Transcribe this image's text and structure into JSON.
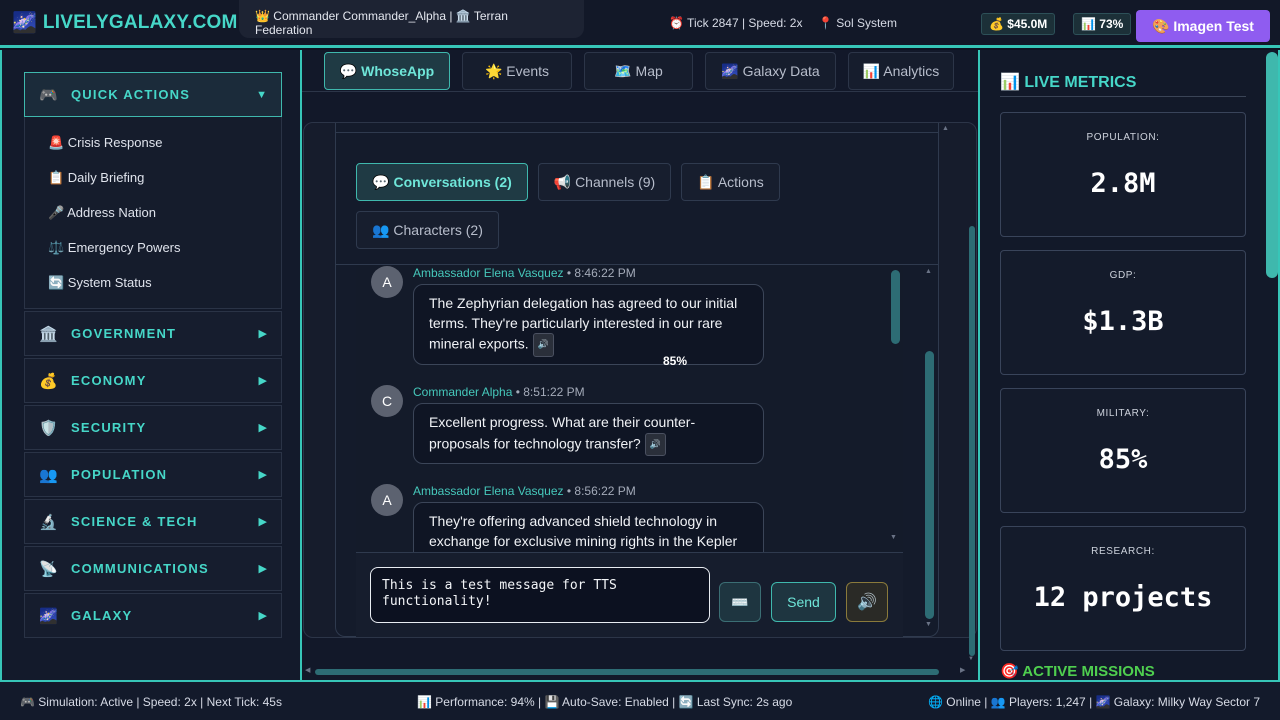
{
  "header": {
    "logo_glyph": "🌌",
    "logo_text": "LIVELYGALAXY.COM",
    "commander": "👑 Commander Commander_Alpha | 🏛️ Terran Federation",
    "tick": "⏰ Tick 2847 | Speed: 2x",
    "location": "📍 Sol System",
    "credits": "💰 $45.0M",
    "approval": "📊 73%",
    "imagen_button": "🎨 Imagen Test"
  },
  "sidebar": {
    "quick_actions": {
      "icon": "🎮",
      "label": "QUICK ACTIONS",
      "arrow": "▼",
      "items": [
        {
          "label": "🚨 Crisis Response"
        },
        {
          "label": "📋 Daily Briefing"
        },
        {
          "label": "🎤 Address Nation"
        },
        {
          "label": "⚖️ Emergency Powers"
        },
        {
          "label": "🔄 System Status"
        }
      ]
    },
    "sections": [
      {
        "icon": "🏛️",
        "label": "GOVERNMENT",
        "arrow": "▶"
      },
      {
        "icon": "💰",
        "label": "ECONOMY",
        "arrow": "▶"
      },
      {
        "icon": "🛡️",
        "label": "SECURITY",
        "arrow": "▶"
      },
      {
        "icon": "👥",
        "label": "POPULATION",
        "arrow": "▶"
      },
      {
        "icon": "🔬",
        "label": "SCIENCE & TECH",
        "arrow": "▶"
      },
      {
        "icon": "📡",
        "label": "COMMUNICATIONS",
        "arrow": "▶"
      },
      {
        "icon": "🌌",
        "label": "GALAXY",
        "arrow": "▶"
      }
    ]
  },
  "main": {
    "tabs": [
      {
        "label": "💬 WhoseApp",
        "active": true
      },
      {
        "label": "🌟 Events"
      },
      {
        "label": "🗺️ Map"
      },
      {
        "label": "🌌 Galaxy Data"
      },
      {
        "label": "📊 Analytics"
      }
    ],
    "subtabs": [
      {
        "label": "💬 Conversations (2)",
        "active": true
      },
      {
        "label": "📢 Channels (9)"
      },
      {
        "label": "📋 Actions"
      },
      {
        "label": "👥 Characters (2)"
      }
    ],
    "messages": [
      {
        "avatar": "A",
        "sender": "Ambassador Elena Vasquez",
        "time": " • 8:46:22 PM",
        "text": "The Zephyrian delegation has agreed to our initial terms. They're particularly interested in our rare mineral exports.",
        "speak": "🔊"
      },
      {
        "avatar": "C",
        "sender": "Commander Alpha",
        "time": " • 8:51:22 PM",
        "text": "Excellent progress. What are their counter-proposals for technology transfer?",
        "speak": "🔊"
      },
      {
        "avatar": "A",
        "sender": "Ambassador Elena Vasquez",
        "time": " • 8:56:22 PM",
        "text": "They're offering advanced shield technology in exchange for exclusive mining rights in the Kepler",
        "speak": ""
      }
    ],
    "volume_overlay": "85%",
    "composer": {
      "input_value": "This is a test message for TTS functionality!",
      "keyboard_button": "⌨️",
      "send_button": "Send",
      "tts_button": "🔊"
    }
  },
  "metrics": {
    "title": "📊 LIVE METRICS",
    "cards": [
      {
        "label": "POPULATION:",
        "value": "2.8M"
      },
      {
        "label": "GDP:",
        "value": "$1.3B"
      },
      {
        "label": "MILITARY:",
        "value": "85%"
      },
      {
        "label": "RESEARCH:",
        "value": "12 projects"
      }
    ],
    "missions_title": "🎯 ACTIVE MISSIONS"
  },
  "footer": {
    "left": "🎮 Simulation: Active | Speed: 2x | Next Tick: 45s",
    "middle": "📊 Performance: 94% | 💾 Auto-Save: Enabled | 🔄 Last Sync: 2s ago",
    "right": "🌐 Online | 👥 Players: 1,247 | 🌌 Galaxy: Milky Way Sector 7"
  },
  "colors": {
    "accent": "#37c6b8",
    "accent_text": "#46d7c8",
    "imagen_button": "#8f5cf0",
    "missions": "#4fcf4f"
  }
}
